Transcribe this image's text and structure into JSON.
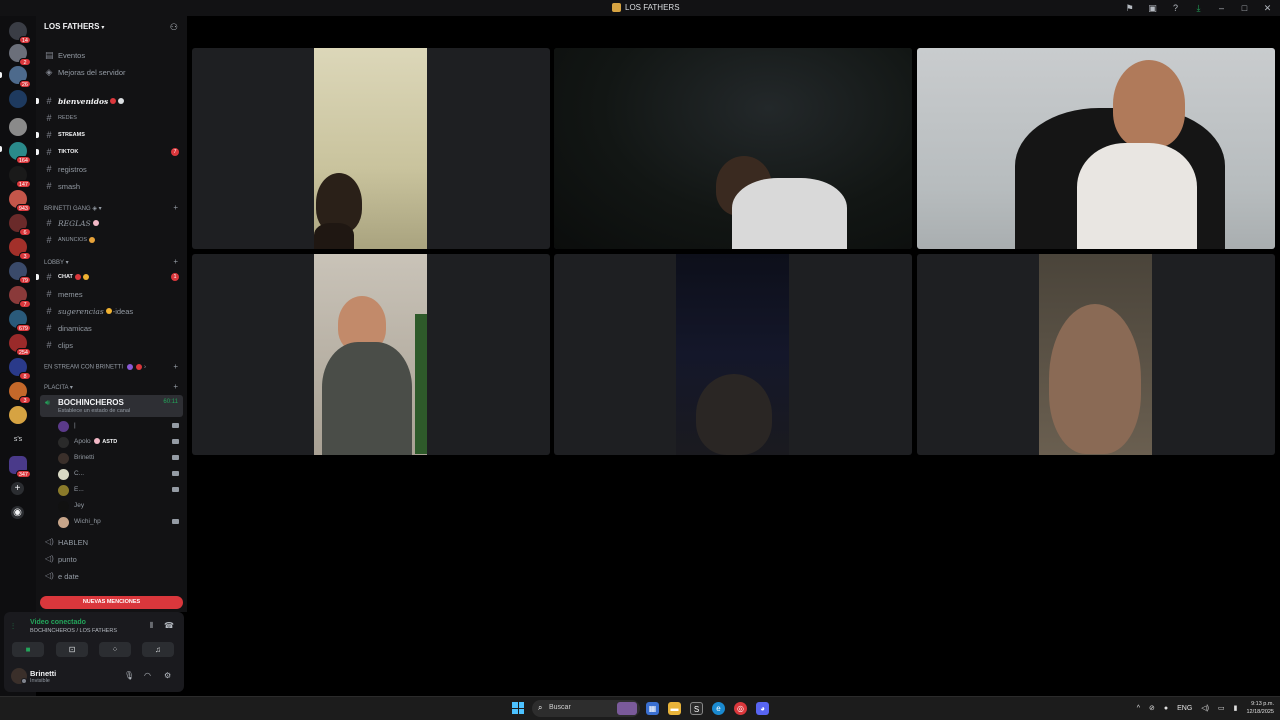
{
  "window": {
    "title": "LOS FATHERS"
  },
  "titlebar_icons": [
    "inbox-icon",
    "screen-icon",
    "help-icon",
    "download-icon",
    "minimize-icon",
    "maximize-icon",
    "close-icon"
  ],
  "rail": {
    "badges": [
      "14",
      "2",
      "26",
      "164",
      "147",
      "943",
      "6",
      "3",
      "79",
      "7",
      "679",
      "254",
      "8",
      "3"
    ],
    "text_server": "s's",
    "badge_last": "347"
  },
  "guild": {
    "name": "LOS FATHERS",
    "top_items": [
      {
        "label": "Eventos"
      },
      {
        "label": "Mejoras del servidor"
      }
    ],
    "channels_a": [
      {
        "label": "bienvenidos",
        "unread": true
      },
      {
        "label": "REDES"
      },
      {
        "label": "STREAMS",
        "unread": true
      },
      {
        "label": "TIKTOK",
        "unread": true,
        "mention": "7"
      },
      {
        "label": "registros"
      },
      {
        "label": "smash"
      }
    ],
    "category_1": "BRINETTI GANG",
    "channels_b": [
      {
        "label": "REGLAS"
      },
      {
        "label": "ANUNCIOS"
      }
    ],
    "category_2": "LOBBY",
    "channels_c": [
      {
        "label": "CHAT",
        "unread": true,
        "mention": "1"
      },
      {
        "label": "memes"
      },
      {
        "label": "sugerencias",
        "suffix": "-ideas"
      },
      {
        "label": "dinamicas"
      },
      {
        "label": "clips"
      }
    ],
    "category_3": "EN STREAM CON BRINETTI",
    "category_4": "PLACITA",
    "active_voice": {
      "name": "BOCHINCHEROS",
      "timer": "60:11",
      "status": "Establece un estado de canal"
    },
    "voice_users": [
      {
        "name": "|",
        "color": "#5b3a8a",
        "cam": true
      },
      {
        "name": "Apolo",
        "tag": "ASTD",
        "color": "#2a2a2a",
        "cam": true
      },
      {
        "name": "Brinetti",
        "color": "#3a2f2a",
        "cam": true
      },
      {
        "name": "C...",
        "color": "#d9d9c4",
        "cam": true
      },
      {
        "name": "E...",
        "color": "#8a7a2a",
        "cam": true
      },
      {
        "name": "Jey",
        "color": "#111111",
        "cam": false
      },
      {
        "name": "Wichi_hp",
        "color": "#c7a58a",
        "cam": true
      }
    ],
    "voice_channels": [
      {
        "label": "HABLEN"
      },
      {
        "label": "punto"
      },
      {
        "label": "e date"
      }
    ],
    "mentions_button": "NUEVAS MENCIONES"
  },
  "voice_panel": {
    "status": "Video conectado",
    "location": "BOCHINCHEROS / LOS FATHERS"
  },
  "user_panel": {
    "name": "Brinetti",
    "status": "Invisible"
  },
  "taskbar": {
    "search": "Buscar",
    "lang": "ENG",
    "time": "9:13 p.m.",
    "date": "12/18/2025"
  }
}
